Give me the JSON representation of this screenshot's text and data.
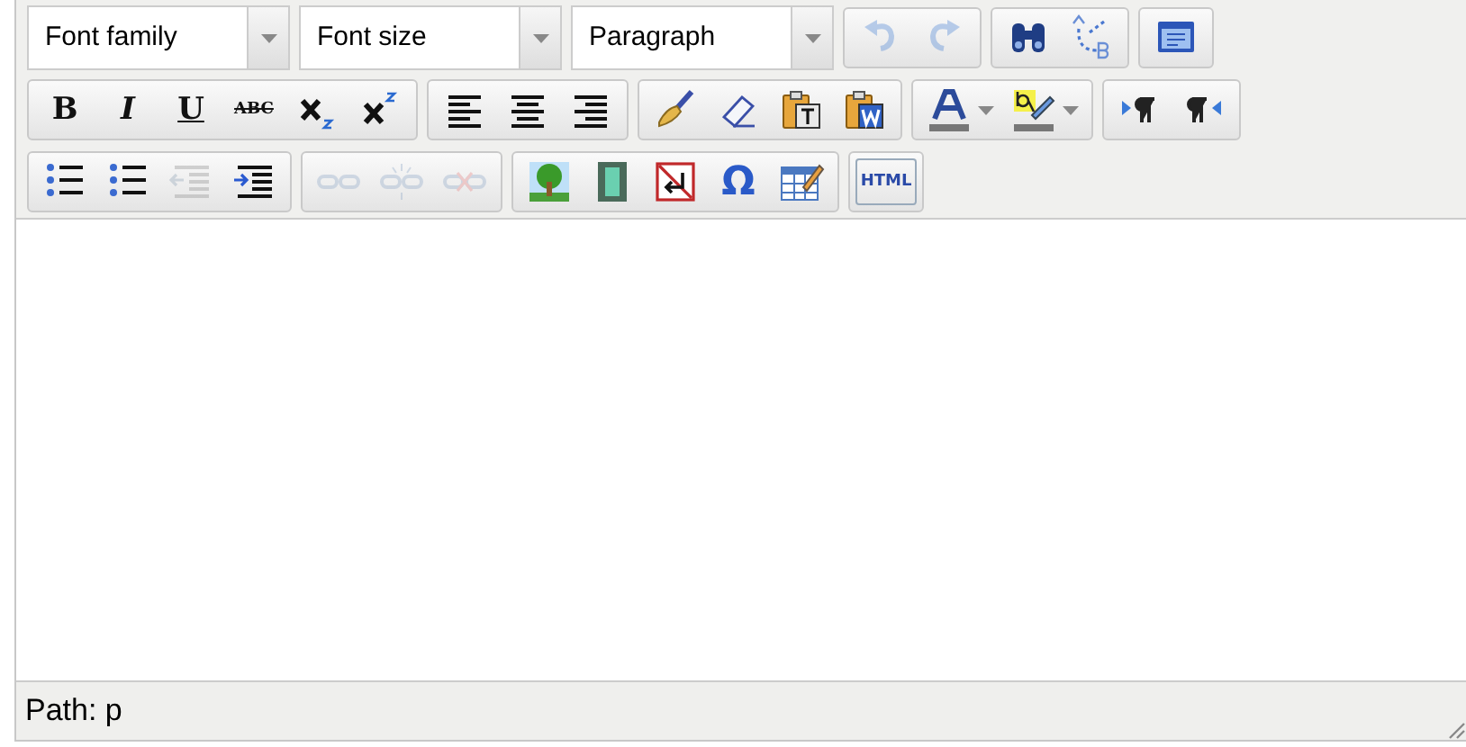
{
  "toolbar_rows": [
    {
      "selects": [
        {
          "value": "Font family"
        },
        {
          "value": "Font size"
        },
        {
          "value": "Paragraph"
        }
      ],
      "groups": [
        [
          {
            "kind": "undo",
            "disabled": true
          },
          {
            "kind": "redo",
            "disabled": true
          }
        ],
        [
          {
            "kind": "find",
            "disabled": false
          },
          {
            "kind": "replace",
            "disabled": false
          }
        ],
        [
          {
            "kind": "fullscreen",
            "disabled": false
          }
        ]
      ]
    },
    {
      "groups": [
        [
          {
            "kind": "bold",
            "label": "B",
            "disabled": false
          },
          {
            "kind": "italic",
            "label": "I",
            "disabled": false
          },
          {
            "kind": "underline",
            "label": "U",
            "disabled": false
          },
          {
            "kind": "strike",
            "label": "ABC",
            "disabled": false
          },
          {
            "kind": "sub",
            "disabled": false
          },
          {
            "kind": "sup",
            "disabled": false
          }
        ],
        [
          {
            "kind": "alignleft",
            "disabled": false
          },
          {
            "kind": "aligncenter",
            "disabled": false
          },
          {
            "kind": "alignright",
            "disabled": false
          }
        ],
        [
          {
            "kind": "cleanup",
            "disabled": false
          },
          {
            "kind": "erase",
            "disabled": false
          },
          {
            "kind": "pastetext",
            "disabled": false
          },
          {
            "kind": "pasteword",
            "disabled": false
          }
        ],
        [
          {
            "kind": "forecolor",
            "disabled": false
          },
          {
            "kind": "backcolor",
            "disabled": false
          }
        ],
        [
          {
            "kind": "ltr",
            "disabled": false
          },
          {
            "kind": "rtl",
            "disabled": false
          }
        ]
      ]
    },
    {
      "groups": [
        [
          {
            "kind": "bullist",
            "disabled": false
          },
          {
            "kind": "numlist",
            "disabled": false
          },
          {
            "kind": "outdent",
            "disabled": true
          },
          {
            "kind": "indent",
            "disabled": false
          }
        ],
        [
          {
            "kind": "link",
            "disabled": true
          },
          {
            "kind": "unlink",
            "disabled": true
          },
          {
            "kind": "anchor",
            "disabled": true
          }
        ],
        [
          {
            "kind": "image",
            "disabled": false
          },
          {
            "kind": "media",
            "disabled": false
          },
          {
            "kind": "nonbreaking",
            "disabled": false
          },
          {
            "kind": "charmap",
            "label": "Ω",
            "disabled": false
          },
          {
            "kind": "table",
            "disabled": false
          }
        ],
        [
          {
            "kind": "code",
            "label": "HTML",
            "disabled": false
          }
        ]
      ]
    }
  ],
  "status_bar": {
    "path": "Path: p"
  }
}
